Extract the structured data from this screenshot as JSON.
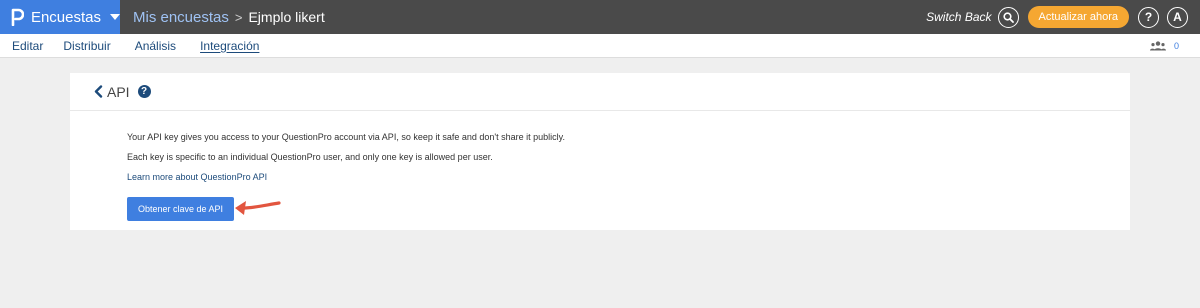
{
  "brand": {
    "name": "Encuestas",
    "color": "#3f7fe0"
  },
  "breadcrumb": {
    "parent": "Mis encuestas",
    "separator": ">",
    "current": "Ejmplo likert"
  },
  "topbar": {
    "switch_back": "Switch Back",
    "upgrade_label": "Actualizar ahora",
    "help_label": "?",
    "avatar_initial": "A",
    "upgrade_color": "#f5a732"
  },
  "subnav": {
    "tabs": [
      "Editar",
      "Distribuir",
      "Análisis",
      "Integración"
    ],
    "active_tab": "Integración",
    "user_count": "0"
  },
  "card": {
    "title": "API",
    "line1": "Your API key gives you access to your QuestionPro account via API, so keep it safe and don't share it publicly.",
    "line2": "Each key is specific to an individual QuestionPro user, and only one key is allowed per user.",
    "learn_more": "Learn more about QuestionPro API",
    "button_label": "Obtener clave de API"
  },
  "annotation": {
    "arrow_color": "#e2553f"
  }
}
